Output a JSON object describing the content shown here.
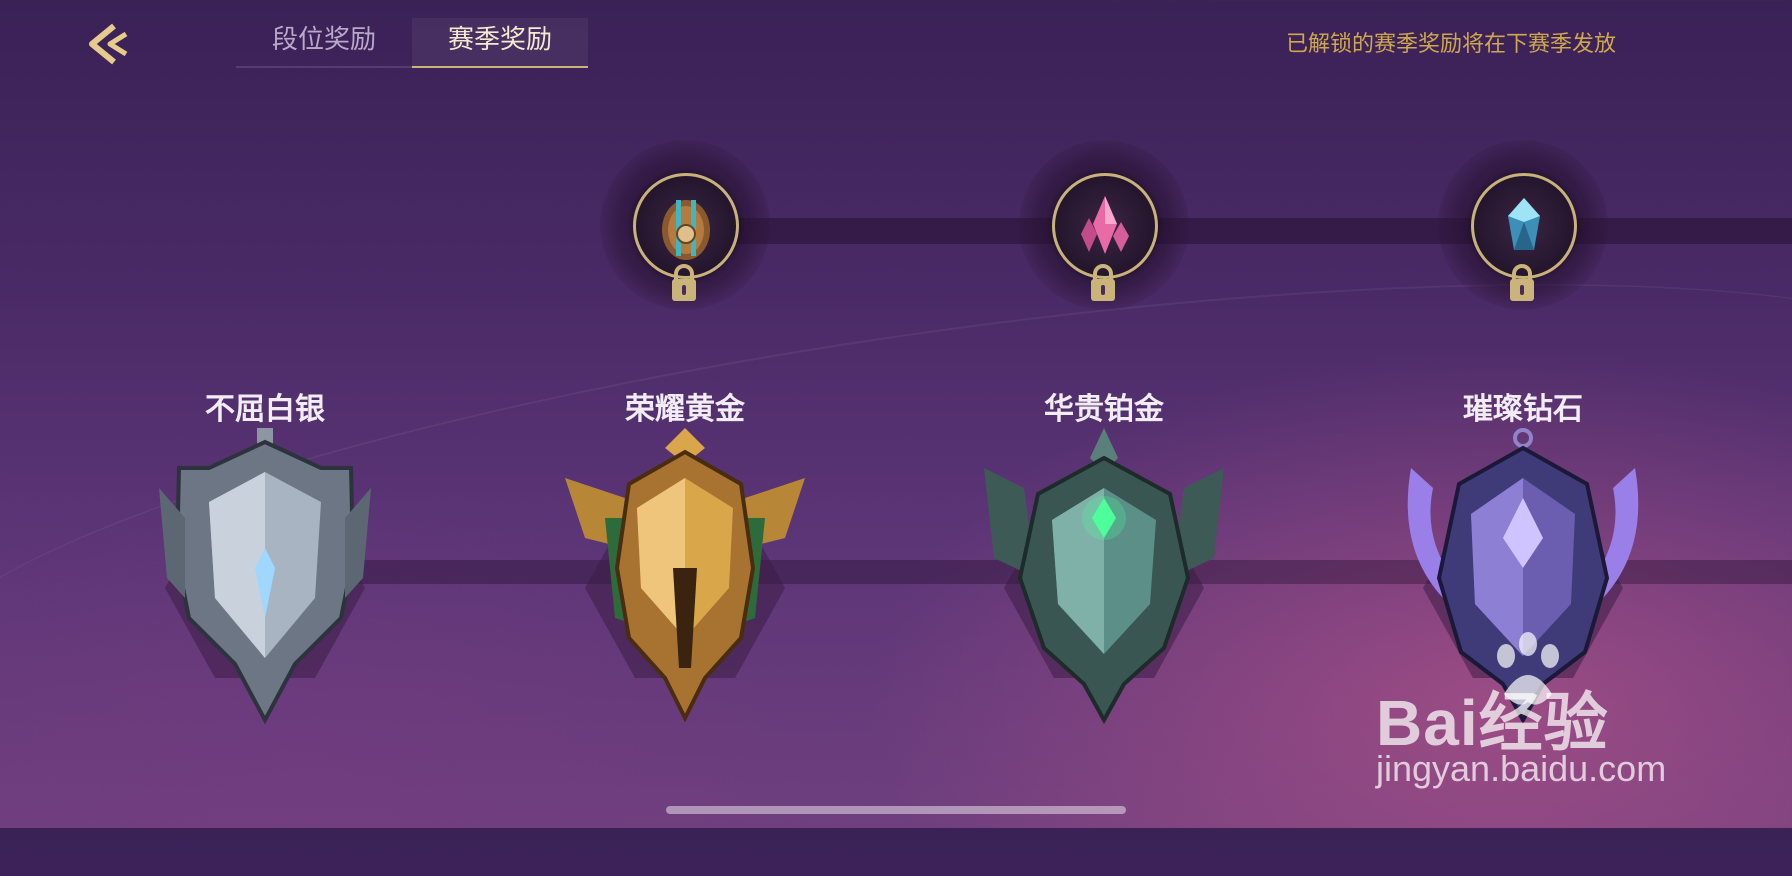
{
  "header": {
    "tabs": [
      {
        "label": "段位奖励",
        "active": false
      },
      {
        "label": "赛季奖励",
        "active": true
      }
    ],
    "notice": "已解锁的赛季奖励将在下赛季发放"
  },
  "rewards": [
    {
      "icon": "summoner-egg-icon",
      "locked": true
    },
    {
      "icon": "pink-crystal-icon",
      "locked": true
    },
    {
      "icon": "blue-crystal-icon",
      "locked": true
    }
  ],
  "ranks": [
    {
      "name": "不屈白银",
      "emblem": "silver-emblem-icon",
      "color": "#a9b4c2"
    },
    {
      "name": "荣耀黄金",
      "emblem": "gold-emblem-icon",
      "color": "#c9963e"
    },
    {
      "name": "华贵铂金",
      "emblem": "platinum-emblem-icon",
      "color": "#4f8a7e"
    },
    {
      "name": "璀璨钻石",
      "emblem": "diamond-emblem-icon",
      "color": "#6b5db0"
    }
  ],
  "watermark": {
    "logo": "Bai经验",
    "url": "jingyan.baidu.com"
  },
  "colors": {
    "accent_gold": "#cfa84e",
    "background_top": "#3a2156",
    "background_bottom": "#6f3f7e"
  }
}
